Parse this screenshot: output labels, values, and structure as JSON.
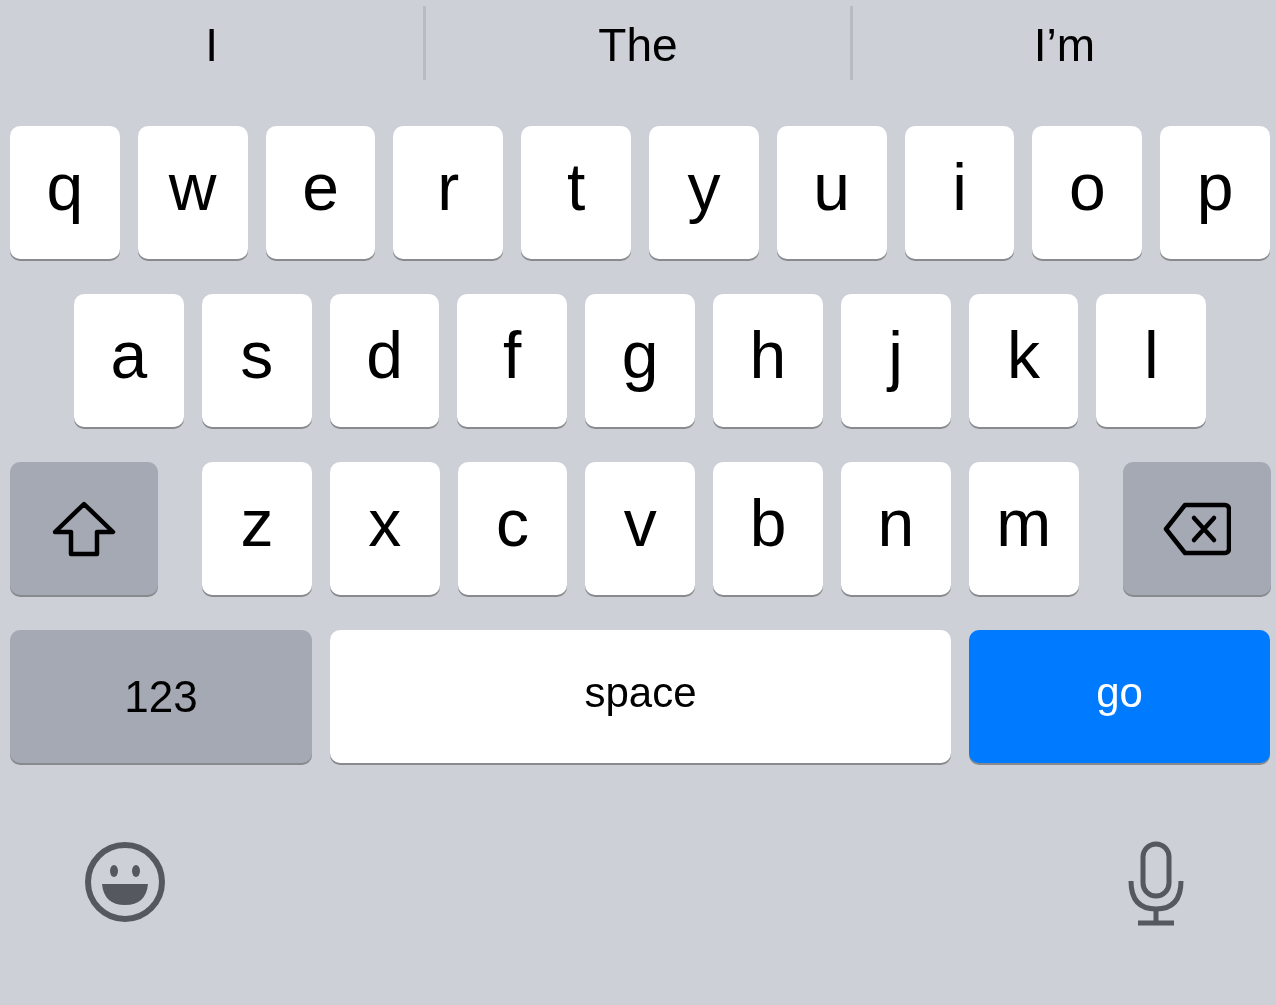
{
  "suggestions": [
    {
      "text": "I"
    },
    {
      "text": "The"
    },
    {
      "text": "I’m"
    }
  ],
  "rows": [
    {
      "keys": [
        {
          "kind": "letter",
          "label": "q"
        },
        {
          "kind": "letter",
          "label": "w"
        },
        {
          "kind": "letter",
          "label": "e"
        },
        {
          "kind": "letter",
          "label": "r"
        },
        {
          "kind": "letter",
          "label": "t"
        },
        {
          "kind": "letter",
          "label": "y"
        },
        {
          "kind": "letter",
          "label": "u"
        },
        {
          "kind": "letter",
          "label": "i"
        },
        {
          "kind": "letter",
          "label": "o"
        },
        {
          "kind": "letter",
          "label": "p"
        }
      ]
    },
    {
      "keys": [
        {
          "kind": "letter",
          "label": "a"
        },
        {
          "kind": "letter",
          "label": "s"
        },
        {
          "kind": "letter",
          "label": "d"
        },
        {
          "kind": "letter",
          "label": "f"
        },
        {
          "kind": "letter",
          "label": "g"
        },
        {
          "kind": "letter",
          "label": "h"
        },
        {
          "kind": "letter",
          "label": "j"
        },
        {
          "kind": "letter",
          "label": "k"
        },
        {
          "kind": "letter",
          "label": "l"
        }
      ]
    },
    {
      "keys": [
        {
          "kind": "shift"
        },
        {
          "kind": "letter",
          "label": "z"
        },
        {
          "kind": "letter",
          "label": "x"
        },
        {
          "kind": "letter",
          "label": "c"
        },
        {
          "kind": "letter",
          "label": "v"
        },
        {
          "kind": "letter",
          "label": "b"
        },
        {
          "kind": "letter",
          "label": "n"
        },
        {
          "kind": "letter",
          "label": "m"
        },
        {
          "kind": "delete"
        }
      ]
    },
    {
      "keys": [
        {
          "kind": "numbers",
          "label": "123"
        },
        {
          "kind": "space",
          "label": "space"
        },
        {
          "kind": "return",
          "label": "go"
        }
      ]
    }
  ]
}
